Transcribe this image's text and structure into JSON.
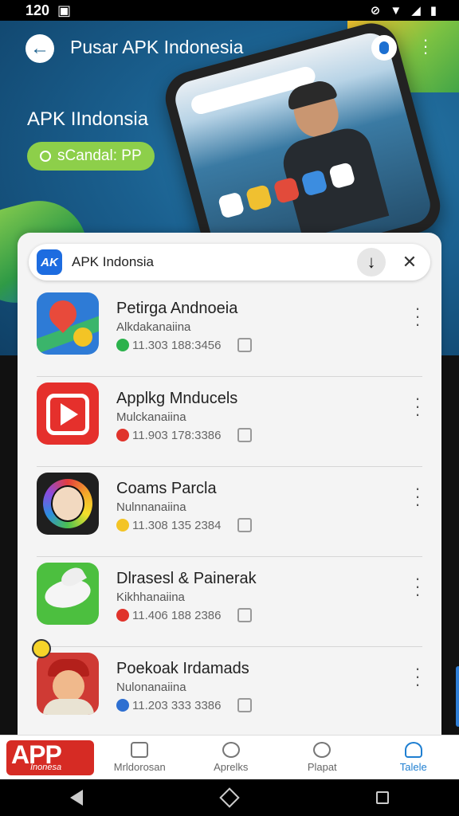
{
  "status_bar": {
    "time": "120",
    "right": "⊘"
  },
  "header": {
    "title": "Pusar APK Indonesia"
  },
  "hero": {
    "heading": "APK IIndonsia",
    "pill_label": "sCandal: PP"
  },
  "card": {
    "title": "APK Indonsia",
    "logo_text": "AK"
  },
  "apps": [
    {
      "name": "Petirga Andnoeia",
      "sub": "Alkdakanaiina",
      "meta": "11.303 188:3456",
      "dot_color": "#2bb24c"
    },
    {
      "name": "Applkg Mnducels",
      "sub": "Mulckanaiina",
      "meta": "11.903 178:3386",
      "dot_color": "#e0332b"
    },
    {
      "name": "Coams Parcla",
      "sub": "Nulnnanaiina",
      "meta": "11.308 135 2384",
      "dot_color": "#f3c425"
    },
    {
      "name": "Dlrasesl & Painerak",
      "sub": "Kikhhanaiina",
      "meta": "11.406 188 2386",
      "dot_color": "#e0332b"
    },
    {
      "name": "Poekoak Irdamads",
      "sub": "Nulonanaiina",
      "meta": "11.203 333 3386",
      "dot_color": "#2e6fd1"
    }
  ],
  "bottom_nav": {
    "brand_big": "APP",
    "brand_small": "Inonesa",
    "items": [
      "Mrldorosan",
      "Aprelks",
      "Plapat",
      "Talele"
    ]
  }
}
